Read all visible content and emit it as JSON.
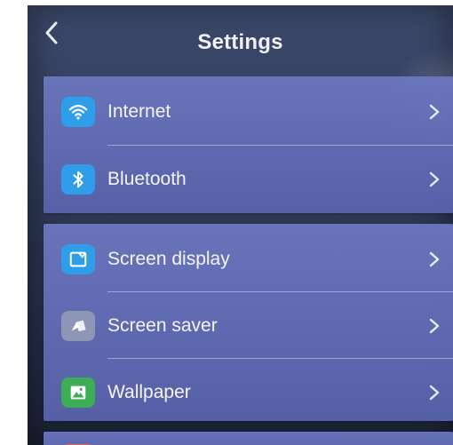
{
  "header": {
    "title": "Settings",
    "back_icon": "chevron-left-icon"
  },
  "groups": [
    {
      "items": [
        {
          "label": "Internet",
          "icon": "wifi-icon",
          "icon_color": "#2f9ee8"
        },
        {
          "label": "Bluetooth",
          "icon": "bluetooth-icon",
          "icon_color": "#2f9ee8"
        }
      ]
    },
    {
      "items": [
        {
          "label": "Screen display",
          "icon": "screen-display-icon",
          "icon_color": "#2f9ee8"
        },
        {
          "label": "Screen saver",
          "icon": "screen-saver-icon",
          "icon_color": "#8e95b5"
        },
        {
          "label": "Wallpaper",
          "icon": "wallpaper-icon",
          "icon_color": "#3dae55"
        }
      ]
    }
  ],
  "colors": {
    "background": "#2c3654",
    "row_background": "#6c76be",
    "text": "#f4f5fb"
  }
}
